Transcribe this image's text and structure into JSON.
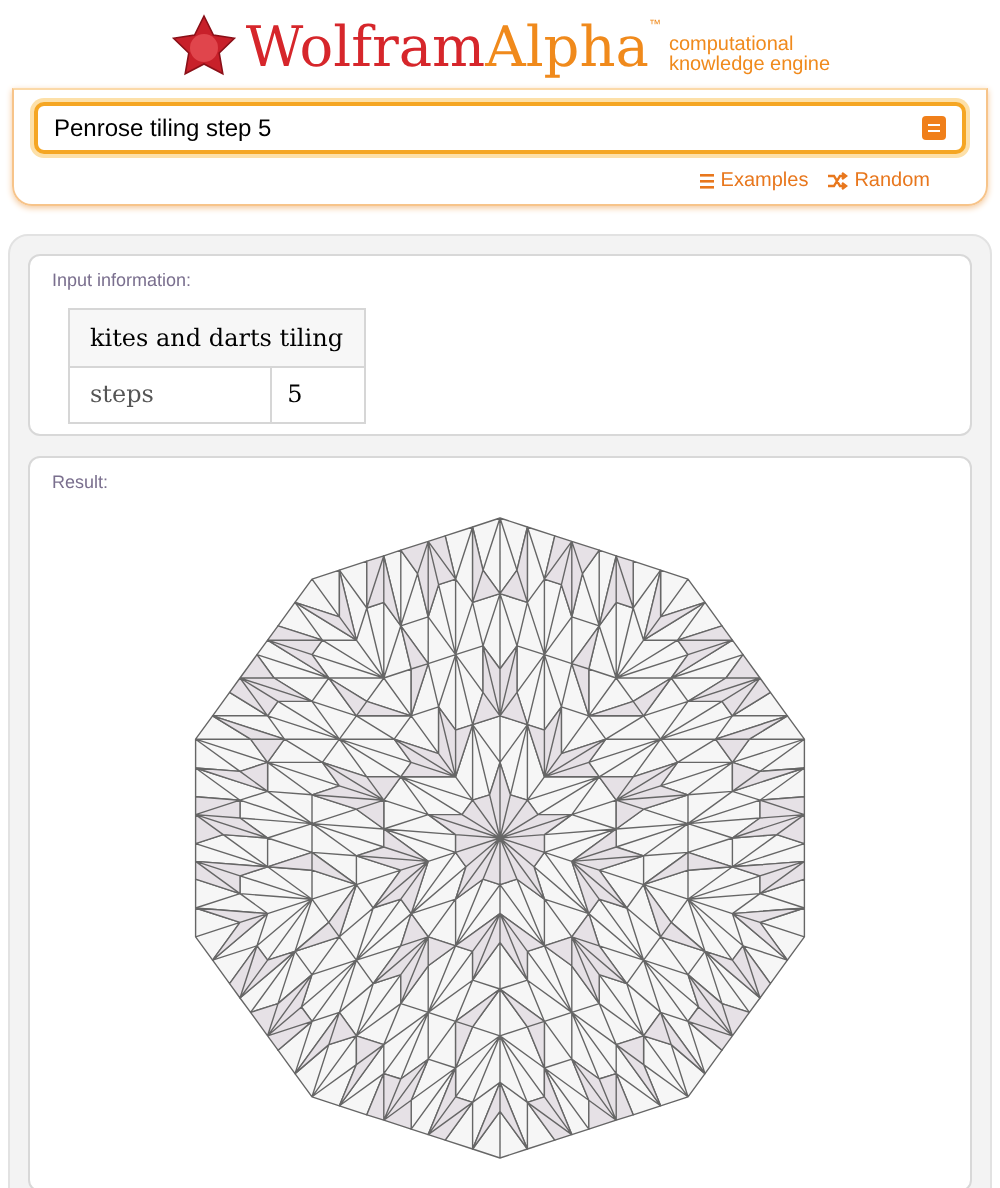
{
  "logo": {
    "word_1": "Wolfram",
    "word_2": "Alpha",
    "trademark": "™",
    "tagline": [
      "computational",
      "knowledge engine"
    ]
  },
  "search": {
    "value": "Penrose tiling step 5"
  },
  "links": [
    {
      "label": "Examples",
      "kind": "examples"
    },
    {
      "label": "Random",
      "kind": "random"
    }
  ],
  "pods": [
    {
      "title": "Input information:",
      "kind": "table",
      "table": {
        "header": "kites and darts tiling",
        "rows": [
          {
            "label": "steps",
            "value": "5"
          }
        ]
      }
    },
    {
      "title": "Result:",
      "kind": "tiling"
    }
  ]
}
